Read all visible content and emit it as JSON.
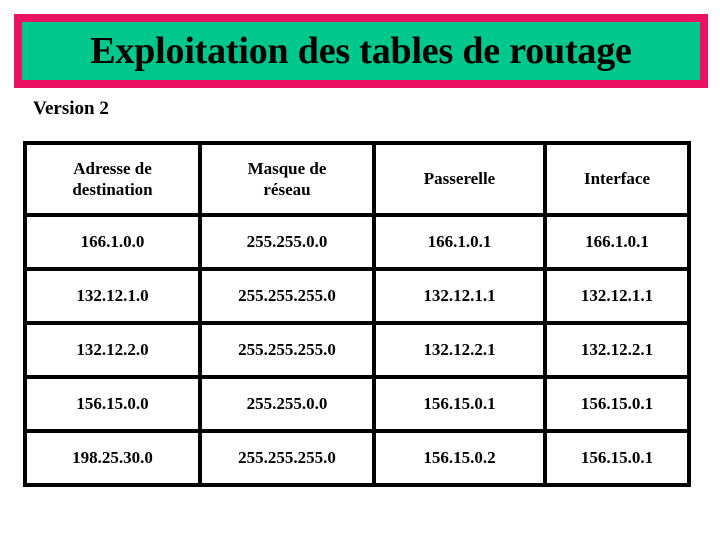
{
  "banner": {
    "title": "Exploitation des tables de routage",
    "border_color": "#ED1164",
    "fill_color": "#00C78C",
    "text_color": "#000000"
  },
  "subtitle": "Version 2",
  "table": {
    "headers": [
      {
        "line1": "Adresse de",
        "line2": "destination"
      },
      {
        "line1": "Masque de",
        "line2": "réseau"
      },
      {
        "line1": "Passerelle",
        "line2": ""
      },
      {
        "line1": "Interface",
        "line2": ""
      }
    ],
    "rows": [
      {
        "destination": "166.1.0.0",
        "mask": "255.255.0.0",
        "gateway": "166.1.0.1",
        "interface": "166.1.0.1"
      },
      {
        "destination": "132.12.1.0",
        "mask": "255.255.255.0",
        "gateway": "132.12.1.1",
        "interface": "132.12.1.1"
      },
      {
        "destination": "132.12.2.0",
        "mask": "255.255.255.0",
        "gateway": "132.12.2.1",
        "interface": "132.12.2.1"
      },
      {
        "destination": "156.15.0.0",
        "mask": "255.255.0.0",
        "gateway": "156.15.0.1",
        "interface": "156.15.0.1"
      },
      {
        "destination": "198.25.30.0",
        "mask": "255.255.255.0",
        "gateway": "156.15.0.2",
        "interface": "156.15.0.1"
      }
    ]
  }
}
